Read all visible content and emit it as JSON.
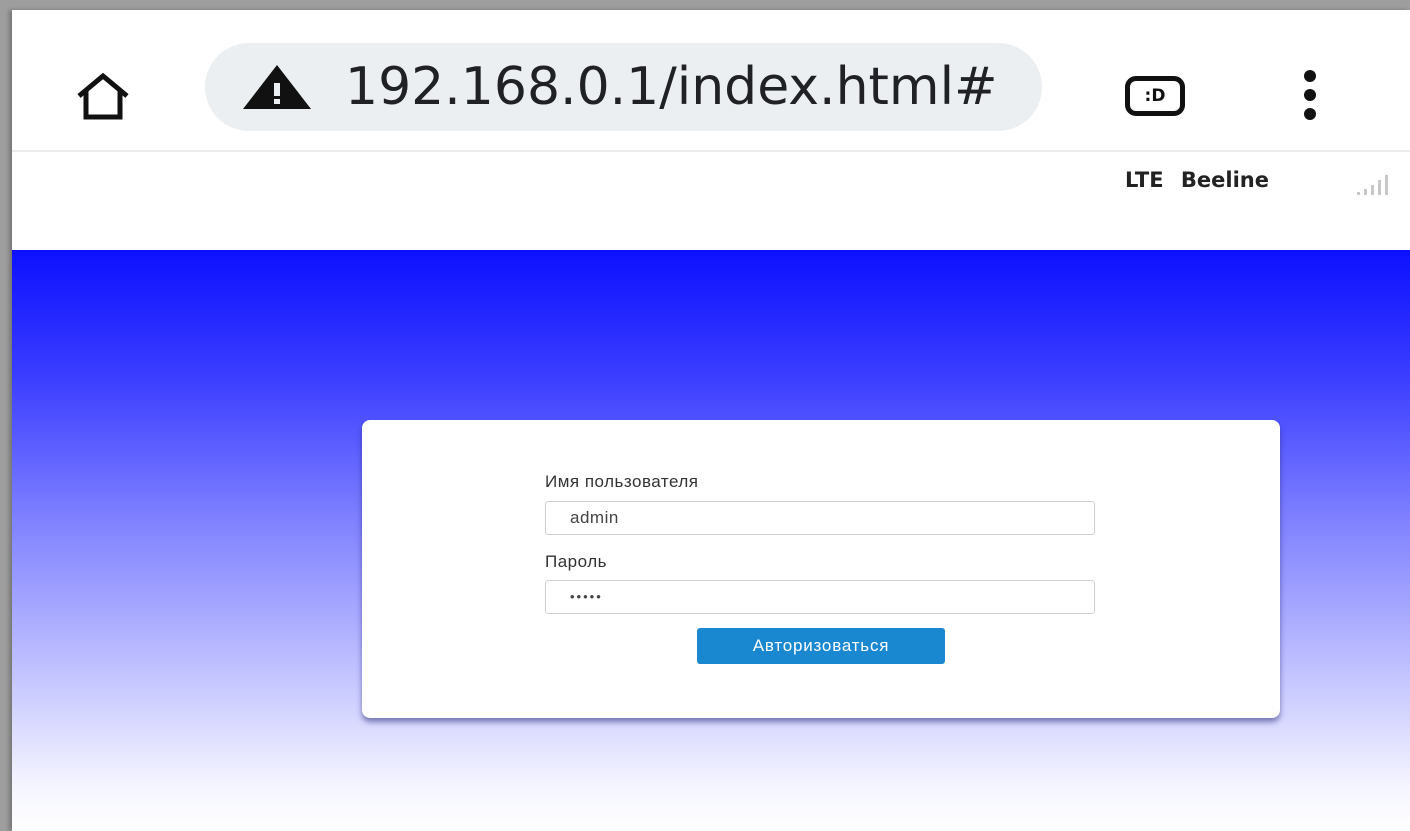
{
  "browser": {
    "url": "192.168.0.1/index.html#",
    "tab_switcher_label": ":D"
  },
  "header": {
    "network_type": "LTE",
    "operator": "Beeline"
  },
  "login_form": {
    "username_label": "Имя пользователя",
    "username_value": "admin",
    "password_label": "Пароль",
    "password_mask": "•••••",
    "submit_label": "Авторизоваться"
  },
  "colors": {
    "gradient_top": "#0c10ff",
    "button": "#1a88d1"
  }
}
